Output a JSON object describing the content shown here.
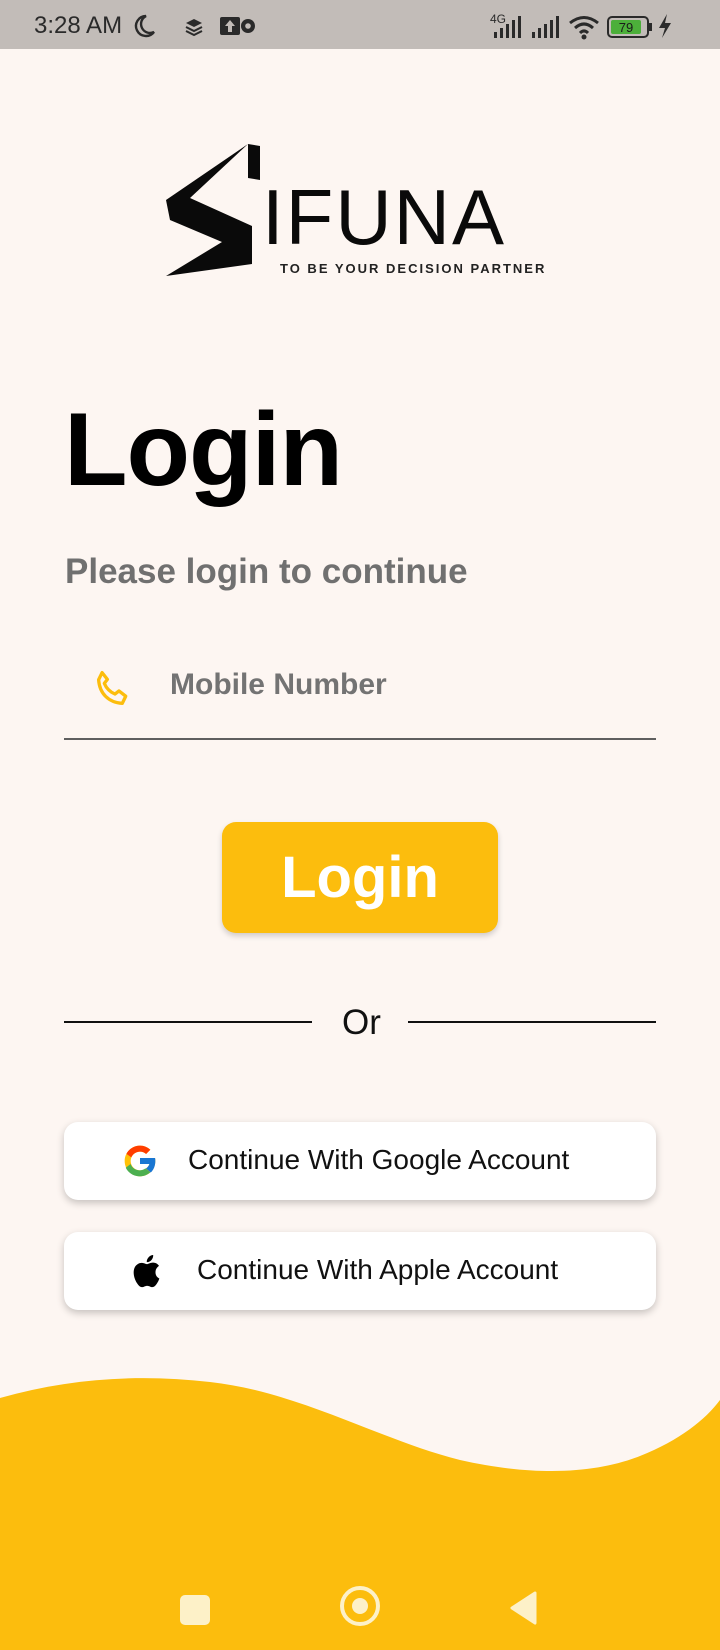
{
  "status_bar": {
    "time": "3:28 AM",
    "network": "4G",
    "battery": "79",
    "icons": [
      "moon-icon",
      "layers-icon",
      "upload-settings-icon",
      "signal-icon",
      "signal-icon",
      "wifi-icon",
      "battery-icon",
      "charging-icon"
    ]
  },
  "logo": {
    "brand": "IFUNA",
    "tagline": "TO BE YOUR DECISION PARTNER"
  },
  "login": {
    "title": "Login",
    "subtitle": "Please login to continue",
    "mobile_placeholder": "Mobile Number",
    "mobile_value": "",
    "button_label": "Login"
  },
  "divider": {
    "text": "Or"
  },
  "social": {
    "google_label": "Continue With Google Account",
    "apple_label": "Continue With Apple Account"
  },
  "colors": {
    "accent": "#fcbd0d",
    "background": "#fdf6f2",
    "subtitle": "#707070"
  },
  "nav_bar": {
    "icons": [
      "recents-square-icon",
      "home-circle-icon",
      "back-triangle-icon"
    ]
  }
}
